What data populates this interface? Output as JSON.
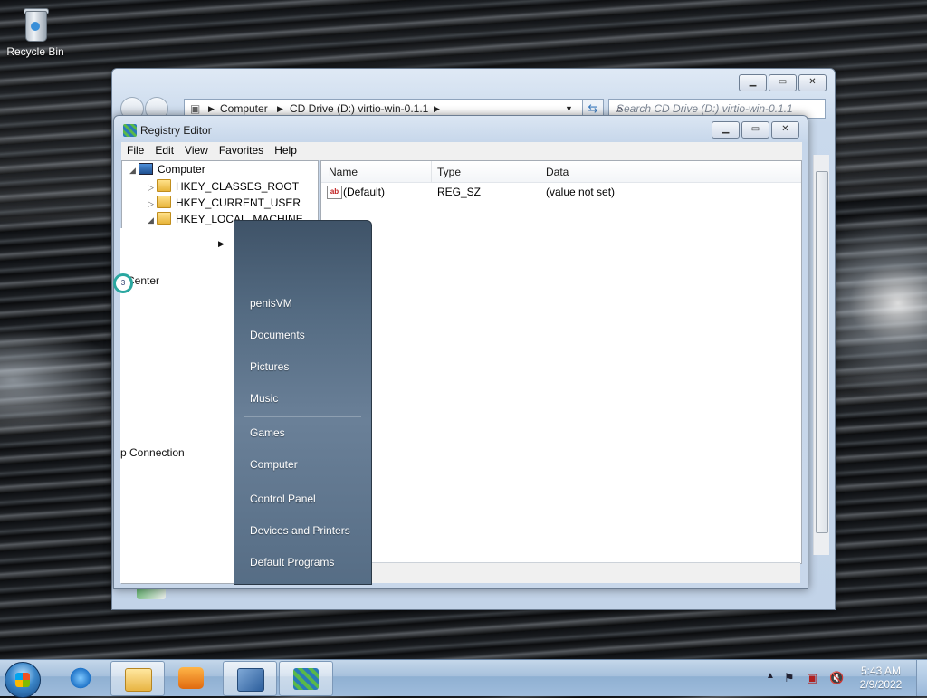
{
  "desktop": {
    "icons": [
      {
        "label": "Recycle Bin",
        "icon": "recycle-bin-icon"
      }
    ]
  },
  "explorer": {
    "address": {
      "seg1": "Computer",
      "seg2": "CD Drive (D:) virtio-win-0.1.1"
    },
    "search_placeholder": "Search CD Drive (D:) virtio-win-0.1.1",
    "buttons": {
      "minimize": "▁",
      "maximize": "▭",
      "close": "✕"
    }
  },
  "regedit": {
    "title": "Registry Editor",
    "menu": [
      "File",
      "Edit",
      "View",
      "Favorites",
      "Help"
    ],
    "tree": {
      "root": "Computer",
      "hives": [
        "HKEY_CLASSES_ROOT",
        "HKEY_CURRENT_USER",
        "HKEY_LOCAL_MACHINE"
      ]
    },
    "columns": [
      "Name",
      "Type",
      "Data"
    ],
    "rows": [
      {
        "name": "(Default)",
        "type": "REG_SZ",
        "data": "(value not set)"
      }
    ],
    "buttons": {
      "minimize": "▁",
      "maximize": "▭",
      "close": "✕"
    }
  },
  "start_menu": {
    "left_items": [
      "Center",
      "p Connection"
    ],
    "right_items": [
      "penisVM",
      "Documents",
      "Pictures",
      "Music",
      "Games",
      "Computer",
      "Control Panel",
      "Devices and Printers",
      "Default Programs"
    ]
  },
  "taskbar": {
    "pinned": [
      "internet-explorer-icon",
      "file-explorer-icon",
      "media-player-icon",
      "network-tool-icon",
      "registry-editor-icon"
    ],
    "tray_icons": [
      "show-hidden-icons-icon",
      "action-center-flag-icon",
      "network-icon",
      "volume-muted-icon"
    ],
    "time": "5:43 AM",
    "date": "2/9/2022"
  }
}
